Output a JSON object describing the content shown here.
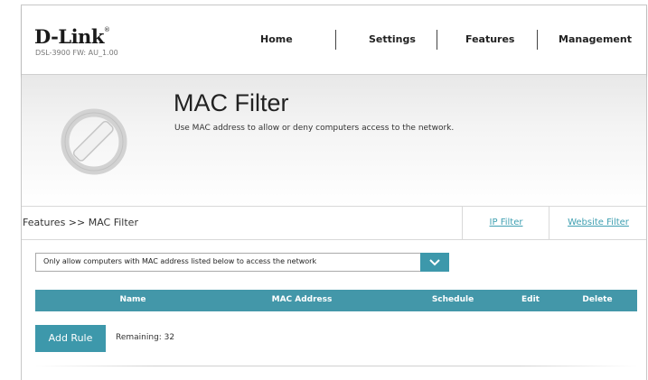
{
  "brand": {
    "logo": "D-Link",
    "model": "DSL-3900   FW: AU_1.00"
  },
  "nav": {
    "items": [
      "Home",
      "Settings",
      "Features",
      "Management"
    ]
  },
  "banner": {
    "title": "MAC Filter",
    "description": "Use MAC address to allow or deny computers access to the network.",
    "icon": "no-entry-icon"
  },
  "breadcrumb": {
    "text": "Features >> MAC Filter"
  },
  "tabs": [
    "IP Filter",
    "Website Filter"
  ],
  "filter_select": {
    "value": "Only allow computers with MAC address listed below to access the network",
    "icon": "chevron-down-icon"
  },
  "table": {
    "columns": [
      "Name",
      "MAC Address",
      "Schedule",
      "Edit",
      "Delete"
    ],
    "rows": []
  },
  "actions": {
    "add_rule_label": "Add Rule",
    "remaining": "Remaining: 32"
  },
  "colors": {
    "accent": "#4397a9",
    "link": "#3e9fb1"
  }
}
